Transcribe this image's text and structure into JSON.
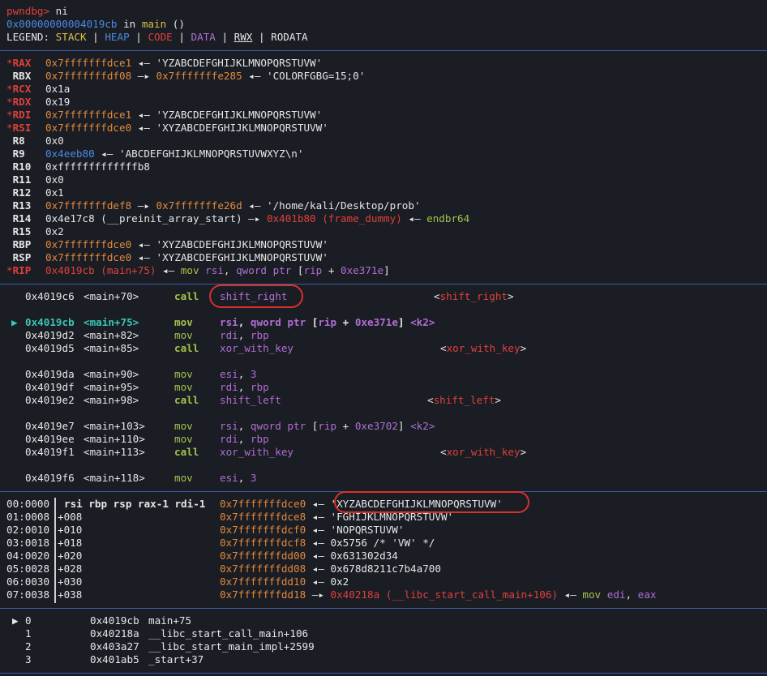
{
  "prompt": {
    "name": "pwndbg>",
    "command": " ni"
  },
  "location": {
    "addr": "0x00000000004019cb",
    "in": " in ",
    "func": "main",
    "args": " ()"
  },
  "legend": {
    "label": "LEGEND: ",
    "stack": "STACK",
    "heap": "HEAP",
    "code": "CODE",
    "data": "DATA",
    "rwx": "RWX",
    "rodata": "RODATA",
    "sep": " | "
  },
  "registers": [
    {
      "mark": "*",
      "name": "RAX",
      "parts": [
        [
          "orange",
          "0x7fffffffdce1"
        ],
        [
          "white",
          " ◂— 'YZABCDEFGHIJKLMNOPQRSTUVW'"
        ]
      ]
    },
    {
      "mark": " ",
      "name": "RBX",
      "parts": [
        [
          "orange",
          "0x7fffffffdf08"
        ],
        [
          "white",
          " —▸ "
        ],
        [
          "orange",
          "0x7fffffffe285"
        ],
        [
          "white",
          " ◂— 'COLORFGBG=15;0'"
        ]
      ]
    },
    {
      "mark": "*",
      "name": "RCX",
      "parts": [
        [
          "white",
          "0x1a"
        ]
      ]
    },
    {
      "mark": "*",
      "name": "RDX",
      "parts": [
        [
          "white",
          "0x19"
        ]
      ]
    },
    {
      "mark": "*",
      "name": "RDI",
      "parts": [
        [
          "orange",
          "0x7fffffffdce1"
        ],
        [
          "white",
          " ◂— 'YZABCDEFGHIJKLMNOPQRSTUVW'"
        ]
      ]
    },
    {
      "mark": "*",
      "name": "RSI",
      "parts": [
        [
          "orange",
          "0x7fffffffdce0"
        ],
        [
          "white",
          " ◂— 'XYZABCDEFGHIJKLMNOPQRSTUVW'"
        ]
      ]
    },
    {
      "mark": " ",
      "name": "R8",
      "parts": [
        [
          "white",
          "0x0"
        ]
      ]
    },
    {
      "mark": " ",
      "name": "R9",
      "parts": [
        [
          "blue",
          "0x4eeb80"
        ],
        [
          "white",
          " ◂— 'ABCDEFGHIJKLMNOPQRSTUVWXYZ\\n'"
        ]
      ]
    },
    {
      "mark": " ",
      "name": "R10",
      "parts": [
        [
          "white",
          "0xfffffffffffffb8"
        ]
      ]
    },
    {
      "mark": " ",
      "name": "R11",
      "parts": [
        [
          "white",
          "0x0"
        ]
      ]
    },
    {
      "mark": " ",
      "name": "R12",
      "parts": [
        [
          "white",
          "0x1"
        ]
      ]
    },
    {
      "mark": " ",
      "name": "R13",
      "parts": [
        [
          "orange",
          "0x7fffffffdef8"
        ],
        [
          "white",
          " —▸ "
        ],
        [
          "orange",
          "0x7fffffffe26d"
        ],
        [
          "white",
          " ◂— '/home/kali/Desktop/prob'"
        ]
      ]
    },
    {
      "mark": " ",
      "name": "R14",
      "parts": [
        [
          "white",
          "0x4e17c8 (__preinit_array_start) —▸ "
        ],
        [
          "red",
          "0x401b80 (frame_dummy)"
        ],
        [
          "white",
          " ◂— "
        ],
        [
          "green",
          "endbr64"
        ]
      ]
    },
    {
      "mark": " ",
      "name": "R15",
      "parts": [
        [
          "white",
          "0x2"
        ]
      ]
    },
    {
      "mark": " ",
      "name": "RBP",
      "parts": [
        [
          "orange",
          "0x7fffffffdce0"
        ],
        [
          "white",
          " ◂— 'XYZABCDEFGHIJKLMNOPQRSTUVW'"
        ]
      ]
    },
    {
      "mark": " ",
      "name": "RSP",
      "parts": [
        [
          "orange",
          "0x7fffffffdce0"
        ],
        [
          "white",
          " ◂— 'XYZABCDEFGHIJKLMNOPQRSTUVW'"
        ]
      ]
    },
    {
      "mark": "*",
      "name": "RIP",
      "parts": [
        [
          "red",
          "0x4019cb (main+75)"
        ],
        [
          "white",
          " ◂— "
        ],
        [
          "green",
          "mov"
        ],
        [
          "white",
          " "
        ],
        [
          "purple",
          "rsi"
        ],
        [
          "white",
          ", "
        ],
        [
          "purple",
          "qword ptr"
        ],
        [
          "white",
          " ["
        ],
        [
          "purple",
          "rip"
        ],
        [
          "white",
          " + "
        ],
        [
          "purple",
          "0xe371e"
        ],
        [
          "white",
          "]"
        ]
      ]
    }
  ],
  "disasm": [
    {
      "arrow": "  ",
      "addr": "0x4019c6",
      "sym": "<main+70>",
      "mn": "call",
      "ops": [
        [
          "purple",
          "shift_right"
        ]
      ],
      "target": "<shift_right>",
      "gap": false,
      "cur": false
    },
    {
      "arrow": "",
      "addr": "",
      "sym": "",
      "mn": "",
      "ops": [],
      "target": "",
      "gap": true,
      "cur": false
    },
    {
      "arrow": "▶ ",
      "addr": "0x4019cb",
      "sym": "<main+75>",
      "mn": "mov",
      "ops": [
        [
          "purple",
          "rsi"
        ],
        [
          "white",
          ", "
        ],
        [
          "purple",
          "qword ptr"
        ],
        [
          "white",
          " ["
        ],
        [
          "purple",
          "rip"
        ],
        [
          "white",
          " + "
        ],
        [
          "purple",
          "0xe371e"
        ],
        [
          "white",
          "] "
        ],
        [
          "purple",
          "<k2>"
        ]
      ],
      "target": "",
      "gap": false,
      "cur": true
    },
    {
      "arrow": "  ",
      "addr": "0x4019d2",
      "sym": "<main+82>",
      "mn": "mov",
      "ops": [
        [
          "purple",
          "rdi"
        ],
        [
          "white",
          ", "
        ],
        [
          "purple",
          "rbp"
        ]
      ],
      "target": "",
      "gap": false,
      "cur": false
    },
    {
      "arrow": "  ",
      "addr": "0x4019d5",
      "sym": "<main+85>",
      "mn": "call",
      "ops": [
        [
          "purple",
          "xor_with_key"
        ]
      ],
      "target": "<xor_with_key>",
      "gap": false,
      "cur": false
    },
    {
      "arrow": "",
      "addr": "",
      "sym": "",
      "mn": "",
      "ops": [],
      "target": "",
      "gap": true,
      "cur": false
    },
    {
      "arrow": "  ",
      "addr": "0x4019da",
      "sym": "<main+90>",
      "mn": "mov",
      "ops": [
        [
          "purple",
          "esi"
        ],
        [
          "white",
          ", "
        ],
        [
          "purple",
          "3"
        ]
      ],
      "target": "",
      "gap": false,
      "cur": false
    },
    {
      "arrow": "  ",
      "addr": "0x4019df",
      "sym": "<main+95>",
      "mn": "mov",
      "ops": [
        [
          "purple",
          "rdi"
        ],
        [
          "white",
          ", "
        ],
        [
          "purple",
          "rbp"
        ]
      ],
      "target": "",
      "gap": false,
      "cur": false
    },
    {
      "arrow": "  ",
      "addr": "0x4019e2",
      "sym": "<main+98>",
      "mn": "call",
      "ops": [
        [
          "purple",
          "shift_left"
        ]
      ],
      "target": "<shift_left>",
      "gap": false,
      "cur": false
    },
    {
      "arrow": "",
      "addr": "",
      "sym": "",
      "mn": "",
      "ops": [],
      "target": "",
      "gap": true,
      "cur": false
    },
    {
      "arrow": "  ",
      "addr": "0x4019e7",
      "sym": "<main+103>",
      "mn": "mov",
      "ops": [
        [
          "purple",
          "rsi"
        ],
        [
          "white",
          ", "
        ],
        [
          "purple",
          "qword ptr"
        ],
        [
          "white",
          " ["
        ],
        [
          "purple",
          "rip"
        ],
        [
          "white",
          " + "
        ],
        [
          "purple",
          "0xe3702"
        ],
        [
          "white",
          "] "
        ],
        [
          "purple",
          "<k2>"
        ]
      ],
      "target": "",
      "gap": false,
      "cur": false
    },
    {
      "arrow": "  ",
      "addr": "0x4019ee",
      "sym": "<main+110>",
      "mn": "mov",
      "ops": [
        [
          "purple",
          "rdi"
        ],
        [
          "white",
          ", "
        ],
        [
          "purple",
          "rbp"
        ]
      ],
      "target": "",
      "gap": false,
      "cur": false
    },
    {
      "arrow": "  ",
      "addr": "0x4019f1",
      "sym": "<main+113>",
      "mn": "call",
      "ops": [
        [
          "purple",
          "xor_with_key"
        ]
      ],
      "target": "<xor_with_key>",
      "gap": false,
      "cur": false
    },
    {
      "arrow": "",
      "addr": "",
      "sym": "",
      "mn": "",
      "ops": [],
      "target": "",
      "gap": true,
      "cur": false
    },
    {
      "arrow": "  ",
      "addr": "0x4019f6",
      "sym": "<main+118>",
      "mn": "mov",
      "ops": [
        [
          "purple",
          "esi"
        ],
        [
          "white",
          ", "
        ],
        [
          "purple",
          "3"
        ]
      ],
      "target": "",
      "gap": false,
      "cur": false
    }
  ],
  "stack": [
    {
      "idx": "00:0000",
      "off": "rsi rbp rsp rax-1 rdi-1",
      "bold": true,
      "parts": [
        [
          "orange",
          "0x7fffffffdce0"
        ],
        [
          "white",
          " ◂— 'XYZABCDEFGHIJKLMNOPQRSTUVW'"
        ]
      ]
    },
    {
      "idx": "01:0008",
      "off": "+008",
      "bold": false,
      "parts": [
        [
          "orange",
          "0x7fffffffdce8"
        ],
        [
          "white",
          " ◂— 'FGHIJKLMNOPQRSTUVW'"
        ]
      ]
    },
    {
      "idx": "02:0010",
      "off": "+010",
      "bold": false,
      "parts": [
        [
          "orange",
          "0x7fffffffdcf0"
        ],
        [
          "white",
          " ◂— 'NOPQRSTUVW'"
        ]
      ]
    },
    {
      "idx": "03:0018",
      "off": "+018",
      "bold": false,
      "parts": [
        [
          "orange",
          "0x7fffffffdcf8"
        ],
        [
          "white",
          " ◂— 0x5756 /* 'VW' */"
        ]
      ]
    },
    {
      "idx": "04:0020",
      "off": "+020",
      "bold": false,
      "parts": [
        [
          "orange",
          "0x7fffffffdd00"
        ],
        [
          "white",
          " ◂— 0x631302d34"
        ]
      ]
    },
    {
      "idx": "05:0028",
      "off": "+028",
      "bold": false,
      "parts": [
        [
          "orange",
          "0x7fffffffdd08"
        ],
        [
          "white",
          " ◂— 0x678d8211c7b4a700"
        ]
      ]
    },
    {
      "idx": "06:0030",
      "off": "+030",
      "bold": false,
      "parts": [
        [
          "orange",
          "0x7fffffffdd10"
        ],
        [
          "white",
          " ◂— 0x2"
        ]
      ]
    },
    {
      "idx": "07:0038",
      "off": "+038",
      "bold": false,
      "parts": [
        [
          "orange",
          "0x7fffffffdd18"
        ],
        [
          "white",
          " —▸ "
        ],
        [
          "red",
          "0x40218a (__libc_start_call_main+106)"
        ],
        [
          "white",
          " ◂— "
        ],
        [
          "green",
          "mov"
        ],
        [
          "white",
          " "
        ],
        [
          "purple",
          "edi"
        ],
        [
          "white",
          ", "
        ],
        [
          "purple",
          "eax"
        ]
      ]
    }
  ],
  "backtrace": [
    {
      "arrow": "▶",
      "num": "0",
      "addr": "0x4019cb",
      "sym": "main+75"
    },
    {
      "arrow": " ",
      "num": "1",
      "addr": "0x40218a",
      "sym": "__libc_start_call_main+106"
    },
    {
      "arrow": " ",
      "num": "2",
      "addr": "0x403a27",
      "sym": "__libc_start_main_impl+2599"
    },
    {
      "arrow": " ",
      "num": "3",
      "addr": "0x401ab5",
      "sym": "_start+37"
    }
  ]
}
